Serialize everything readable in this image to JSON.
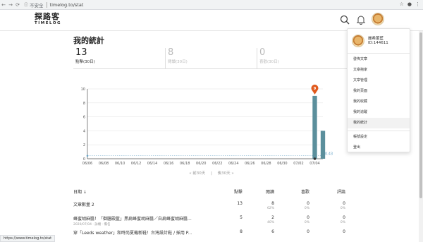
{
  "browser": {
    "security": "不安全",
    "url": "timelog.to/stat",
    "status_url": "https://www.timelog.to/stat"
  },
  "header": {
    "logo_cn": "探路客",
    "logo_en": "TIMELOG"
  },
  "page": {
    "title": "我的統計",
    "tabs": [
      {
        "num": "13",
        "label": "點擊(30日)"
      },
      {
        "num": "8",
        "label": "閱讀(30日)"
      },
      {
        "num": "0",
        "label": "喜歡(30日)"
      }
    ],
    "pager": {
      "prev": "« 前30天",
      "sep": "|",
      "next": "後30天 »"
    }
  },
  "chart_data": {
    "type": "bar",
    "categories": [
      "06/06",
      "06/07",
      "06/08",
      "06/09",
      "06/10",
      "06/11",
      "06/12",
      "06/13",
      "06/14",
      "06/15",
      "06/16",
      "06/17",
      "06/18",
      "06/19",
      "06/20",
      "06/21",
      "06/22",
      "06/23",
      "06/24",
      "06/25",
      "06/26",
      "06/27",
      "06/28",
      "06/29",
      "06/30",
      "07/01",
      "07/02",
      "07/03",
      "07/04",
      "07/05"
    ],
    "tick_labels": [
      "06/06",
      "06/08",
      "06/10",
      "06/12",
      "06/14",
      "06/16",
      "06/18",
      "06/20",
      "06/22",
      "06/24",
      "06/26",
      "06/28",
      "06/30",
      "07/02",
      "07/04"
    ],
    "values": [
      0,
      0,
      0,
      0,
      0,
      0,
      0,
      0,
      0,
      0,
      0,
      0,
      0,
      0,
      0,
      0,
      0,
      0,
      0,
      0,
      0,
      0,
      0,
      0,
      0,
      0,
      0,
      0,
      9,
      4
    ],
    "ylim": [
      0,
      10
    ],
    "yticks": [
      0,
      2,
      4,
      6,
      8,
      10
    ],
    "average": 0.43,
    "average_label": "0.43",
    "peak_label": "9",
    "colors": {
      "bar": "#5b8f9c",
      "marker": "#e05a1e",
      "avg": "#6aa6c8"
    }
  },
  "table": {
    "headers": {
      "date": "日期 ↓",
      "clicks": "點擊",
      "reads": "閱讀",
      "likes": "喜歡",
      "comments": "評論"
    },
    "rows": [
      {
        "title": "文章數量 2",
        "meta": "",
        "clicks": "13",
        "reads": "8",
        "reads_pct": "62%",
        "likes": "0",
        "likes_pct": "0%",
        "comments": "0",
        "comments_pct": "0%"
      },
      {
        "title": "蜂蜜胡麻醬！「御膳殿藍」黑扁蜂蜜胡麻醬／白扁蜂蜜胡麻醬...",
        "meta": "2020/07/04 · 詠緒 · 備名",
        "clicks": "5",
        "reads": "2",
        "reads_pct": "40%",
        "likes": "0",
        "likes_pct": "0%",
        "comments": "0",
        "comments_pct": "0%"
      },
      {
        "title": "穿「Leeds weather」和時尚夏機新鞋！台灣設計鞋 / 採用 P...",
        "meta": "",
        "clicks": "8",
        "reads": "6",
        "reads_pct": "",
        "likes": "0",
        "likes_pct": "",
        "comments": "0",
        "comments_pct": ""
      }
    ]
  },
  "dropdown": {
    "username": "麗希蕾藍",
    "user_id": "ID:144611",
    "items": [
      "發佈文章",
      "文章抱家",
      "文章管理",
      "我的頁面",
      "我的收藏",
      "我的追蹤",
      "我的統計"
    ],
    "settings": [
      "帳號設定",
      "登出"
    ],
    "active_index": 6
  }
}
